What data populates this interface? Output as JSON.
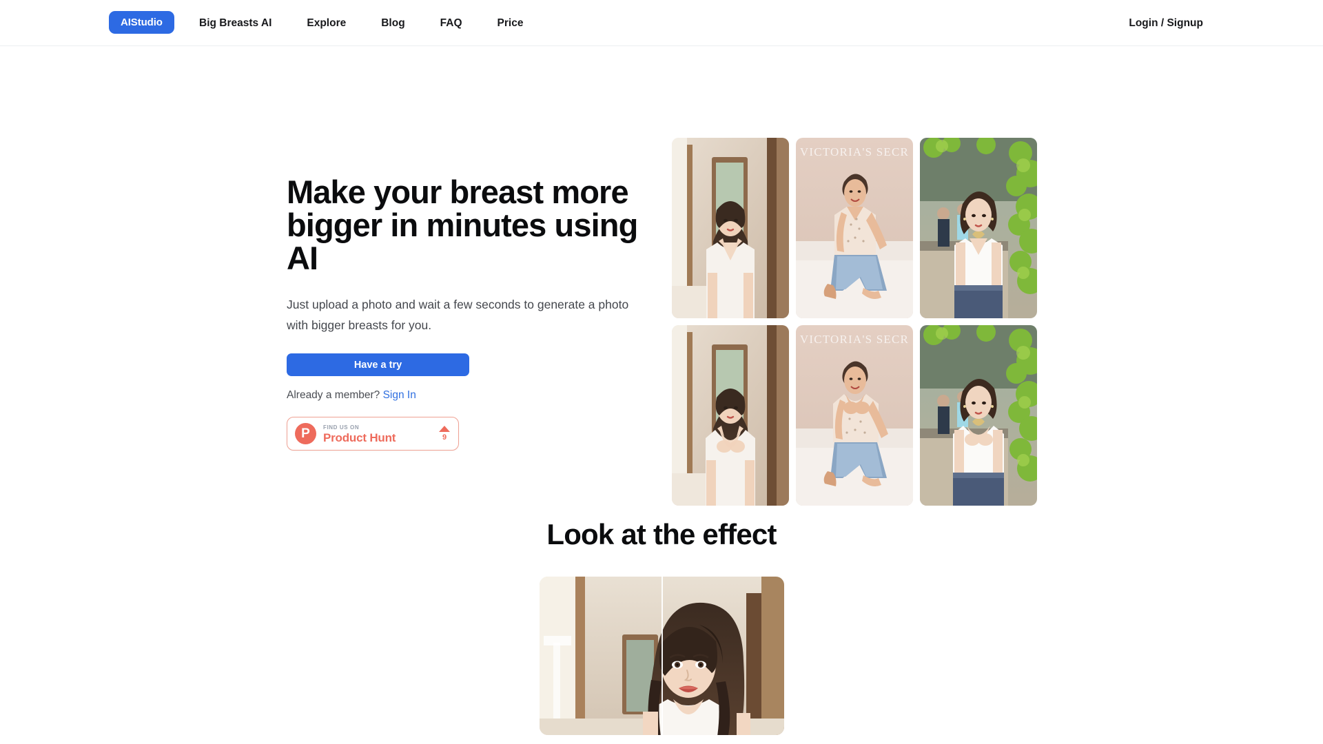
{
  "theme": {
    "accent": "#2d6ae3",
    "link": "#2f6fe0",
    "text_primary": "#0b0c0e",
    "text_secondary": "#44474d",
    "producthunt": "#ee6b5c",
    "border": "#eceef1",
    "background": "#ffffff"
  },
  "navbar": {
    "brand": "AIStudio",
    "links": [
      {
        "label": "Big Breasts AI"
      },
      {
        "label": "Explore"
      },
      {
        "label": "Blog"
      },
      {
        "label": "FAQ"
      },
      {
        "label": "Price"
      }
    ],
    "auth": "Login / Signup"
  },
  "hero": {
    "title": "Make your breast more bigger in minutes using AI",
    "subtitle": "Just upload a photo and wait a few seconds to generate a photo with bigger breasts for you.",
    "cta_label": "Have a try",
    "member_prompt": "Already a member?",
    "sign_in_label": "Sign In",
    "product_hunt": {
      "kicker": "FIND US ON",
      "name": "Product Hunt",
      "mark_letter": "P",
      "upvotes": "9",
      "arrow_icon": "triangle-up-icon"
    },
    "gallery": [
      {
        "alt": "woman-white-camisole-indoor-before",
        "scene": "indoor-door"
      },
      {
        "alt": "woman-floral-top-jeans-bed-before",
        "scene": "victorias-secret"
      },
      {
        "alt": "woman-white-croptop-street-before",
        "scene": "street-greenery"
      },
      {
        "alt": "woman-white-camisole-indoor-after",
        "scene": "indoor-door"
      },
      {
        "alt": "woman-floral-top-jeans-bed-after",
        "scene": "victorias-secret"
      },
      {
        "alt": "woman-white-croptop-street-after",
        "scene": "street-greenery"
      }
    ],
    "gallery_overlay_text": "VICTORIA'S SECR"
  },
  "effect_section": {
    "title": "Look at the effect",
    "comparison": {
      "alt": "before-after-portrait-comparison",
      "divider": "split-handle"
    }
  }
}
